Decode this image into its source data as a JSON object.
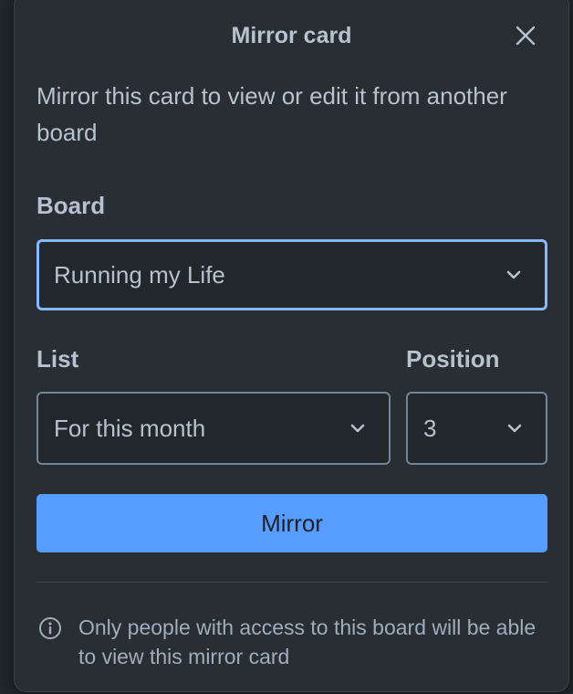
{
  "dialog": {
    "title": "Mirror card",
    "description": "Mirror this card to view or edit it from another board"
  },
  "board": {
    "label": "Board",
    "selected": "Running my Life"
  },
  "list": {
    "label": "List",
    "selected": "For this month"
  },
  "position": {
    "label": "Position",
    "selected": "3"
  },
  "actions": {
    "mirror_label": "Mirror"
  },
  "footer": {
    "note": "Only people with access to this board will be able to view this mirror card"
  },
  "icons": {
    "close": "close-icon",
    "chevron": "chevron-down-icon",
    "info": "info-icon"
  },
  "colors": {
    "background": "#282e33",
    "text": "#b6c2cf",
    "focus_border": "#85b8ff",
    "primary_button": "#579dff"
  }
}
